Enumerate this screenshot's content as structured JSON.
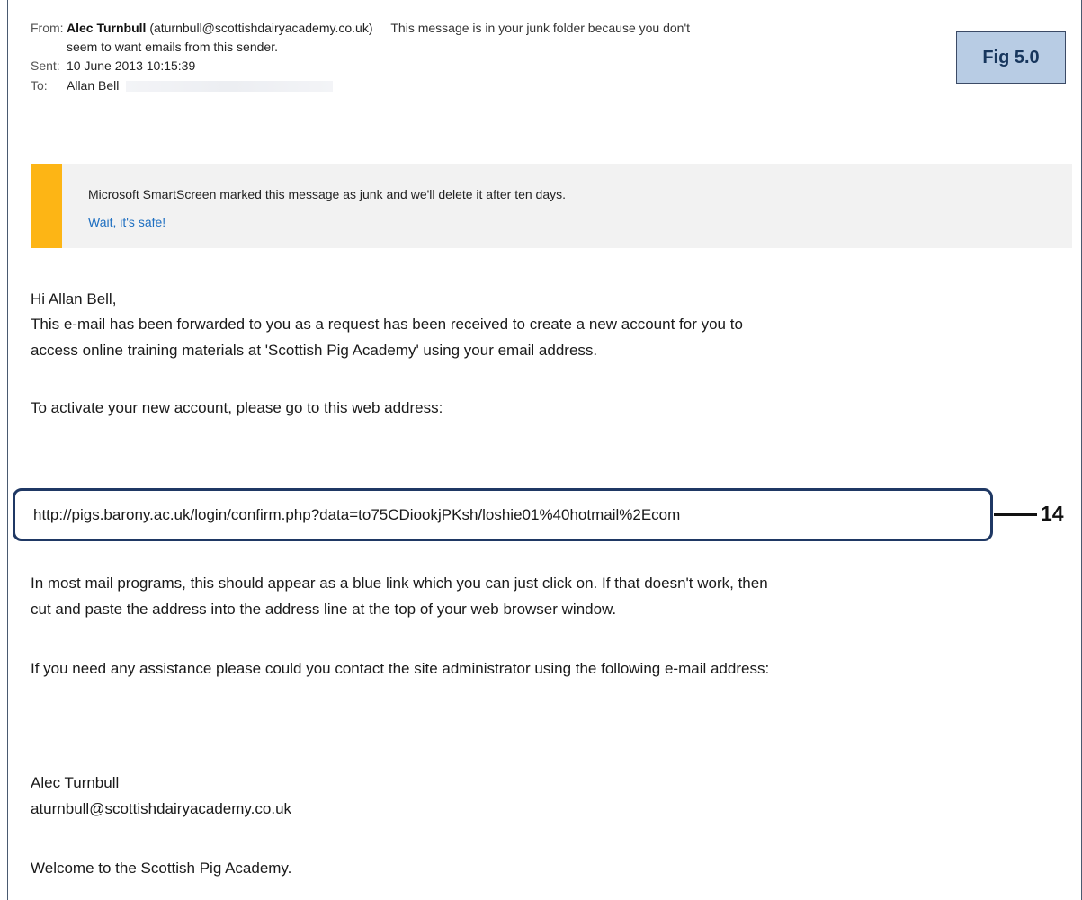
{
  "header": {
    "from_label": "From:",
    "from_name": "Alec Turnbull",
    "from_email": "(aturnbull@scottishdairyacademy.co.uk)",
    "junk_notice_line1": "This message is in your junk folder because you don't",
    "junk_notice_line2": "seem to want emails from this sender.",
    "sent_label": "Sent:",
    "sent_value": "10 June 2013 10:15:39",
    "to_label": "To:",
    "to_value": "Allan Bell"
  },
  "figure_label": "Fig 5.0",
  "junk_banner": {
    "message": "Microsoft SmartScreen marked this message as junk and we'll delete it after ten days.",
    "safe_link": "Wait, it's safe!",
    "accent_color": "#fdb515"
  },
  "body": {
    "greeting": "Hi Allan Bell,",
    "para1_line1": "This e-mail has been forwarded to you as a request has been received to create a new account for you to",
    "para1_line2": "access online training materials at 'Scottish Pig Academy' using your email address.",
    "para2": "To activate your new account, please go to this web address:",
    "url": "http://pigs.barony.ac.uk/login/confirm.php?data=to75CDiookjPKsh/loshie01%40hotmail%2Ecom",
    "para3_line1": "In most mail programs, this should appear as a blue link which you can just click on. If that doesn't work, then",
    "para3_line2": "cut and paste the address into the address line at the top of your web browser window.",
    "para4": "If you need any assistance please could you contact the site administrator using the following e-mail address:",
    "signature_name": "Alec Turnbull",
    "signature_email": "aturnbull@scottishdairyacademy.co.uk",
    "closing": "Welcome to the Scottish Pig Academy."
  },
  "callout": {
    "number": "14"
  }
}
